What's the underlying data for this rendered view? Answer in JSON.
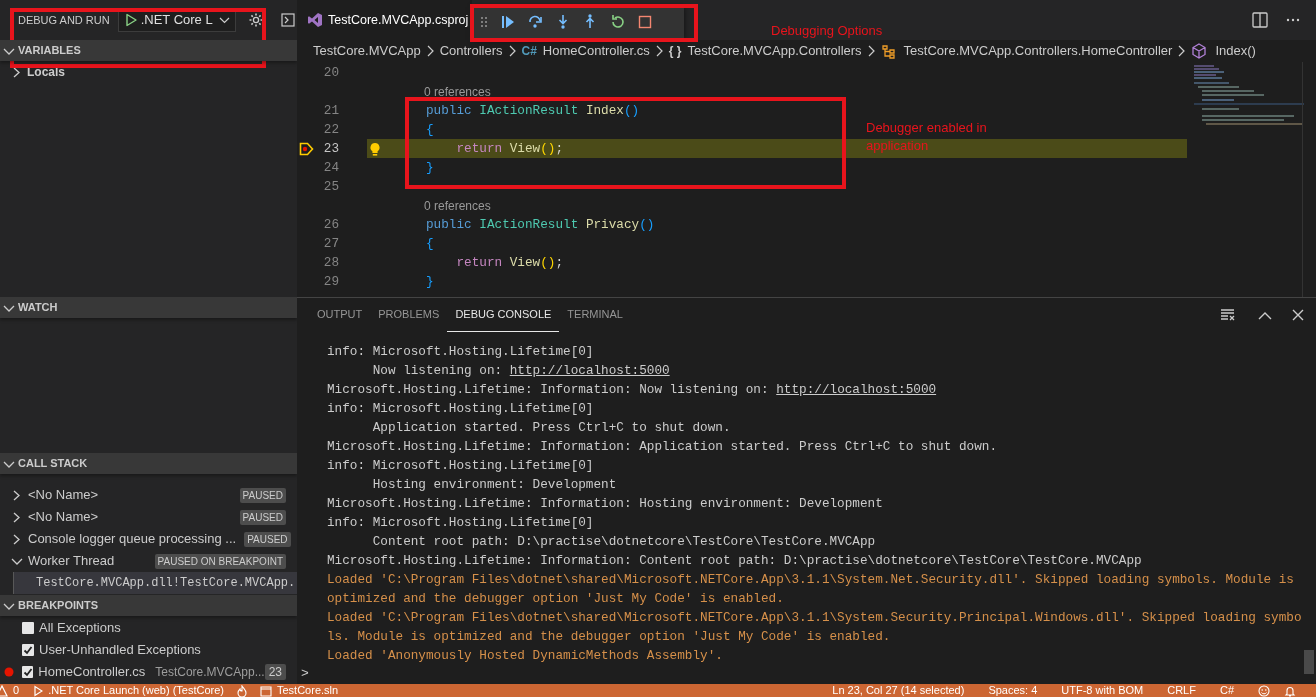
{
  "sidebar": {
    "title": "DEBUG AND RUN",
    "configuration": ".NET Core L",
    "sections": [
      {
        "kind": "variables",
        "title": "VARIABLES",
        "expanded": true,
        "items": [
          {
            "label": "Locals",
            "expanded": false
          }
        ]
      },
      {
        "kind": "watch",
        "title": "WATCH",
        "expanded": true
      },
      {
        "kind": "callstack",
        "title": "CALL STACK",
        "expanded": true,
        "threads": [
          {
            "label": "<No Name>",
            "status": "PAUSED",
            "expanded": false
          },
          {
            "label": "<No Name>",
            "status": "PAUSED",
            "expanded": false
          },
          {
            "label": "Console logger queue processing ...",
            "status": "PAUSED",
            "expanded": false
          },
          {
            "label": "Worker Thread",
            "status": "PAUSED ON BREAKPOINT",
            "expanded": true,
            "children": [
              {
                "label": "TestCore.MVCApp.dll!TestCore.MVCApp."
              }
            ]
          }
        ]
      },
      {
        "kind": "breakpoints",
        "title": "BREAKPOINTS",
        "expanded": true,
        "items": [
          {
            "kind": "exception",
            "label": "All Exceptions",
            "checked": false
          },
          {
            "kind": "exception",
            "label": "User-Unhandled Exceptions",
            "checked": true
          },
          {
            "kind": "file",
            "label": "HomeController.cs",
            "checked": true,
            "path": "TestCore.MVCApp...",
            "line": "23"
          }
        ]
      }
    ]
  },
  "editor": {
    "tabs": [
      {
        "label": "TestCore.MVCApp.csproj",
        "selected": true
      }
    ],
    "breadcrumb": [
      {
        "kind": "folder",
        "label": "TestCore.MVCApp"
      },
      {
        "kind": "folder",
        "label": "Controllers"
      },
      {
        "kind": "file",
        "icon_text": "C#",
        "label": "HomeController.cs"
      },
      {
        "kind": "namespace",
        "icon_text": "{ }",
        "label": "TestCore.MVCApp.Controllers"
      },
      {
        "kind": "class",
        "label": "TestCore.MVCApp.Controllers.HomeController"
      },
      {
        "kind": "method",
        "label": "Index()"
      }
    ],
    "lines": [
      {
        "kind": "code",
        "number": "20",
        "current": false
      },
      {
        "kind": "codelens",
        "text": "0 references"
      },
      {
        "kind": "code",
        "number": "21",
        "current": false,
        "tokens": [
          {
            "text": "public",
            "kind": "keyword"
          },
          {
            "text": " IActionResult",
            "kind": "type"
          },
          {
            "text": " Index",
            "kind": "method"
          },
          {
            "text": "()",
            "kind": "bracket_blue"
          }
        ]
      },
      {
        "kind": "code",
        "number": "22",
        "current": false,
        "tokens": [
          {
            "text": "{",
            "kind": "bracket_blue"
          }
        ]
      },
      {
        "kind": "code",
        "number": "23",
        "current": true,
        "tokens": [
          {
            "text": "    return",
            "kind": "control"
          },
          {
            "text": " View",
            "kind": "method"
          },
          {
            "text": "()",
            "kind": "bracket_gold"
          },
          {
            "text": ";",
            "kind": "plain"
          }
        ]
      },
      {
        "kind": "code",
        "number": "24",
        "current": false,
        "tokens": [
          {
            "text": "}",
            "kind": "bracket_blue"
          }
        ]
      },
      {
        "kind": "code",
        "number": "25",
        "current": false
      },
      {
        "kind": "codelens",
        "text": "0 references"
      },
      {
        "kind": "code",
        "number": "26",
        "current": false,
        "tokens": [
          {
            "text": "public",
            "kind": "keyword"
          },
          {
            "text": " IActionResult",
            "kind": "type"
          },
          {
            "text": " Privacy",
            "kind": "method"
          },
          {
            "text": "()",
            "kind": "bracket_blue"
          }
        ]
      },
      {
        "kind": "code",
        "number": "27",
        "current": false,
        "tokens": [
          {
            "text": "{",
            "kind": "bracket_blue"
          }
        ]
      },
      {
        "kind": "code",
        "number": "28",
        "current": false,
        "tokens": [
          {
            "text": "    return",
            "kind": "control"
          },
          {
            "text": " View",
            "kind": "method"
          },
          {
            "text": "()",
            "kind": "bracket_gold"
          },
          {
            "text": ";",
            "kind": "plain"
          }
        ]
      },
      {
        "kind": "code",
        "number": "29",
        "current": false,
        "tokens": [
          {
            "text": "}",
            "kind": "bracket_blue"
          }
        ]
      }
    ]
  },
  "panel": {
    "tabs": [
      {
        "label": "OUTPUT",
        "selected": false
      },
      {
        "label": "PROBLEMS",
        "selected": false
      },
      {
        "label": "DEBUG CONSOLE",
        "selected": true
      },
      {
        "label": "TERMINAL",
        "selected": false
      }
    ],
    "console": [
      {
        "kind": "plain",
        "text": "info: Microsoft.Hosting.Lifetime[0]"
      },
      {
        "kind": "plain",
        "text": "      Now listening on: ",
        "link": "http://localhost:5000"
      },
      {
        "kind": "plain",
        "text": "Microsoft.Hosting.Lifetime: Information: Now listening on: ",
        "link": "http://localhost:5000"
      },
      {
        "kind": "plain",
        "text": "info: Microsoft.Hosting.Lifetime[0]"
      },
      {
        "kind": "plain",
        "text": "      Application started. Press Ctrl+C to shut down."
      },
      {
        "kind": "plain",
        "text": "Microsoft.Hosting.Lifetime: Information: Application started. Press Ctrl+C to shut down."
      },
      {
        "kind": "plain",
        "text": "info: Microsoft.Hosting.Lifetime[0]"
      },
      {
        "kind": "plain",
        "text": "      Hosting environment: Development"
      },
      {
        "kind": "plain",
        "text": "Microsoft.Hosting.Lifetime: Information: Hosting environment: Development"
      },
      {
        "kind": "plain",
        "text": "info: Microsoft.Hosting.Lifetime[0]"
      },
      {
        "kind": "plain",
        "text": "      Content root path: D:\\practise\\dotnetcore\\TestCore\\TestCore.MVCApp"
      },
      {
        "kind": "plain",
        "text": "Microsoft.Hosting.Lifetime: Information: Content root path: D:\\practise\\dotnetcore\\TestCore\\TestCore.MVCApp"
      },
      {
        "kind": "loaded",
        "text": "Loaded 'C:\\Program Files\\dotnet\\shared\\Microsoft.NETCore.App\\3.1.1\\System.Net.Security.dll'. Skipped loading symbols. Module is optimized and the debugger option 'Just My Code' is enabled."
      },
      {
        "kind": "loaded",
        "text": "Loaded 'C:\\Program Files\\dotnet\\shared\\Microsoft.NETCore.App\\3.1.1\\System.Security.Principal.Windows.dll'. Skipped loading symbols. Module is optimized and the debugger option 'Just My Code' is enabled."
      },
      {
        "kind": "loaded",
        "text": "Loaded 'Anonymously Hosted DynamicMethods Assembly'."
      }
    ],
    "prompt": ">"
  },
  "status_bar": {
    "left": [
      {
        "kind": "problems",
        "text": "0"
      },
      {
        "kind": "launch",
        "text": ".NET Core Launch (web) (TestCore)"
      },
      {
        "kind": "solution",
        "text": "TestCore.sln"
      }
    ],
    "right": [
      "Ln 23, Col 27 (14 selected)",
      "Spaces: 4",
      "UTF-8 with BOM",
      "CRLF",
      "C#"
    ]
  },
  "annotations": [
    {
      "kind": "toolbar",
      "text": "Debugging Options"
    },
    {
      "kind": "code",
      "text": "Debugger enabled in application"
    }
  ]
}
